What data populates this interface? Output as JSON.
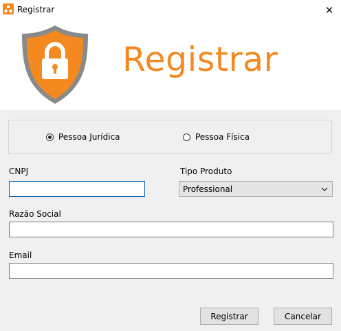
{
  "window": {
    "title": "Registrar",
    "close_icon": "close-icon"
  },
  "banner": {
    "title": "Registrar",
    "accent_color": "#f4891f",
    "icon": "lock-shield-icon"
  },
  "radios": [
    {
      "label": "Pessoa Jurídica",
      "checked": true
    },
    {
      "label": "Pessoa Física",
      "checked": false
    }
  ],
  "form": {
    "cnpj_label": "CNPJ",
    "cnpj_value": "",
    "tipo_label": "Tipo Produto",
    "tipo_value": "Professional",
    "razao_label": "Razão Social",
    "razao_value": "",
    "email_label": "Email",
    "email_value": ""
  },
  "buttons": {
    "registrar": "Registrar",
    "cancelar": "Cancelar"
  }
}
